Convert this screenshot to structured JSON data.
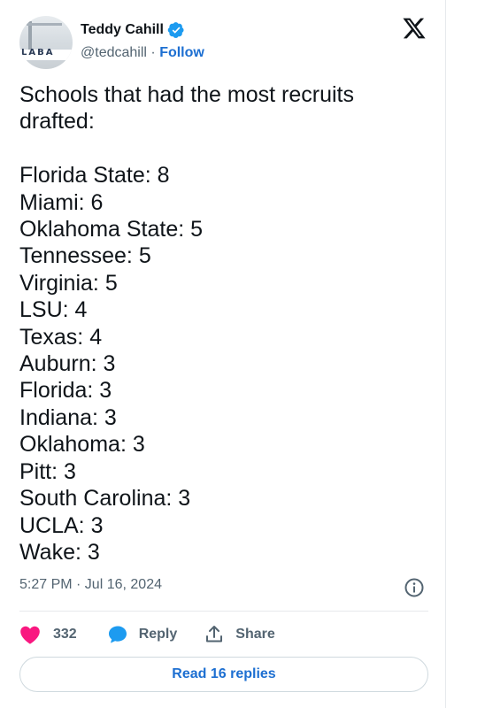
{
  "author": {
    "name": "Teddy Cahill",
    "handle": "@tedcahill",
    "separator": "·",
    "follow_label": "Follow",
    "avatar_text": "LABA"
  },
  "tweet": {
    "intro_lines": [
      "Schools that had the most recruits",
      "drafted:"
    ],
    "entries": [
      "Florida State: 8",
      "Miami: 6",
      "Oklahoma State: 5",
      "Tennessee: 5",
      "Virginia: 5",
      "LSU: 4",
      "Texas: 4",
      "Auburn: 3",
      "Florida: 3",
      "Indiana: 3",
      "Oklahoma: 3",
      "Pitt: 3",
      "South Carolina: 3",
      "UCLA: 3",
      "Wake: 3"
    ],
    "timestamp": "5:27 PM · Jul 16, 2024"
  },
  "actions": {
    "like_count": "332",
    "reply_label": "Reply",
    "share_label": "Share"
  },
  "read_replies_label": "Read 16 replies",
  "colors": {
    "like": "#f91880",
    "reply_icon": "#1d9bf0",
    "link": "#1d6fd1",
    "verified": "#1d9bf0",
    "muted": "#536471"
  },
  "icons": [
    "verified-badge-icon",
    "x-logo-icon",
    "info-icon",
    "heart-icon",
    "speech-bubble-icon",
    "share-upload-icon"
  ]
}
